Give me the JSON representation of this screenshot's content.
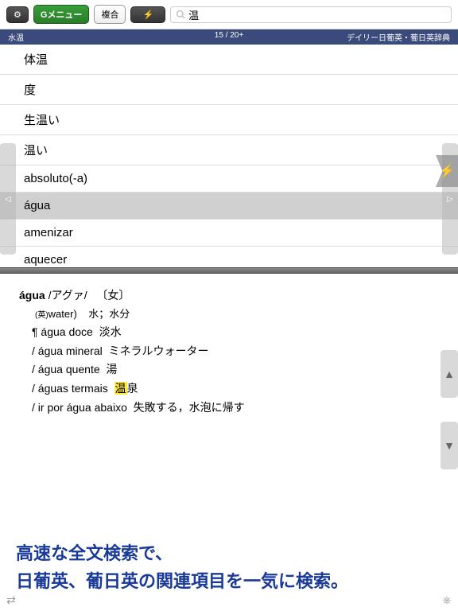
{
  "toolbar": {
    "gear": "⚙",
    "menu_label": "Gメニュー",
    "compound_label": "複合",
    "thunder": "⚡"
  },
  "search": {
    "value": "温"
  },
  "status": {
    "left": "水温",
    "count": "15 / 20+",
    "source": "デイリー日葡英・葡日英辞典"
  },
  "results": [
    {
      "label": "体温"
    },
    {
      "label": "度"
    },
    {
      "label": "生温い"
    },
    {
      "label": "温い"
    },
    {
      "label": "absoluto(-a)"
    },
    {
      "label": "água"
    },
    {
      "label": "amenizar"
    },
    {
      "label": "aquecer"
    }
  ],
  "detail": {
    "headword": "água",
    "pronunciation": "/アグァ/",
    "gender": "〔女〕",
    "english_tag": "(英)",
    "english": "water)",
    "meaning": "水；水分",
    "examples": [
      {
        "pt": "¶ água doce",
        "jp": "淡水"
      },
      {
        "pt": "/ água mineral",
        "jp": "ミネラルウォーター"
      },
      {
        "pt": "/ água quente",
        "jp": "湯"
      },
      {
        "pt": "/ águas termais",
        "jp_pre": "",
        "hl": "温",
        "jp_post": "泉"
      },
      {
        "pt": "/ ir por água abaixo",
        "jp": "失敗する，水泡に帰す"
      }
    ]
  },
  "promo": {
    "line1": "高速な全文検索で、",
    "line2": "日葡英、葡日英の関連項目を一気に検索。"
  },
  "nav": {
    "left_arrows": "⇄",
    "wheel": "⎈"
  }
}
